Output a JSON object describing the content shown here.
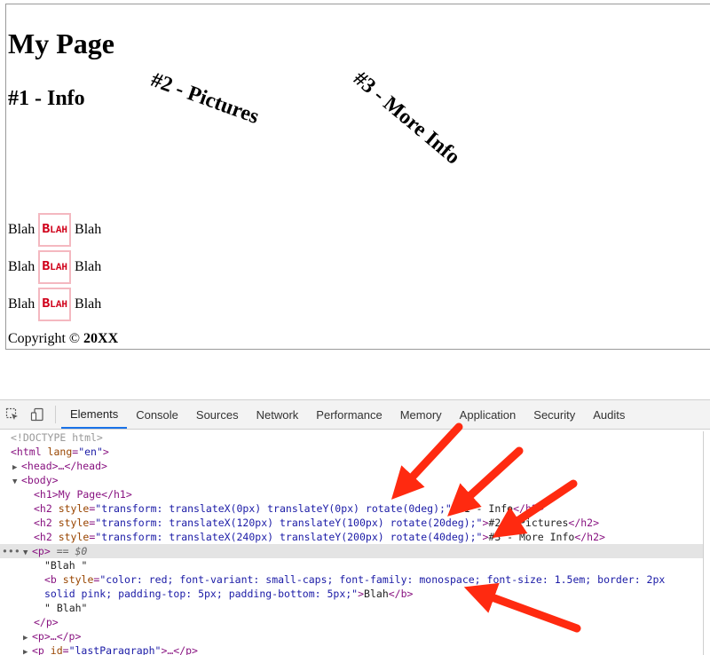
{
  "page": {
    "h1": "My Page",
    "h2_1": "#1 - Info",
    "h2_2": "#2 - Pictures",
    "h2_3": "#3 - More Info",
    "blah_before": "Blah",
    "blah_bold": "Blah",
    "blah_after": "Blah",
    "copyright_prefix": "Copyright ©",
    "copyright_year": "20XX"
  },
  "devtools": {
    "tabs": [
      "Elements",
      "Console",
      "Sources",
      "Network",
      "Performance",
      "Memory",
      "Application",
      "Security",
      "Audits"
    ],
    "active_tab": "Elements",
    "icons": [
      "inspect-element-icon",
      "device-toolbar-icon"
    ],
    "tree": {
      "doctype": "<!DOCTYPE html>",
      "html_open": "<html ",
      "html_attr": "lang",
      "html_val": "\"en\"",
      "head": "<head>…</head>",
      "body_open": "<body>",
      "h1_line": "<h1>My Page</h1>",
      "h2_open": "<h2 ",
      "style_attr": "style",
      "h2a_style": "\"transform: translateX(0px) translateY(0px) rotate(0deg);\"",
      "h2a_text": "#1 - Info",
      "h2b_style": "\"transform: translateX(120px) translateY(100px) rotate(20deg);\"",
      "h2b_text": "#2 - Pictures",
      "h2c_style": "\"transform: translateX(240px) translateY(200px) rotate(40deg);\"",
      "h2c_text": "#3 - More Info",
      "h2_close": "</h2>",
      "p_open": "<p>",
      "p_sel_suffix": "== $0",
      "text_blah1": "\"Blah \"",
      "b_open": "<b ",
      "b_style_1": "\"color: red; font-variant: small-caps; font-family: monospace; font-size: 1.5em; border: 2px",
      "b_style_2": "solid pink; padding-top: 5px; padding-bottom: 5px;\"",
      "b_text": "Blah",
      "b_close": "</b>",
      "text_blah2": "\" Blah\"",
      "p_close": "</p>",
      "p_collapsed": "<p>…</p>",
      "p_last_open": "<p ",
      "id_attr": "id",
      "p_last_val": "\"lastParagraph\"",
      "p_last_rest": ">…</p>"
    },
    "annotation_color": "#ff2a10"
  }
}
